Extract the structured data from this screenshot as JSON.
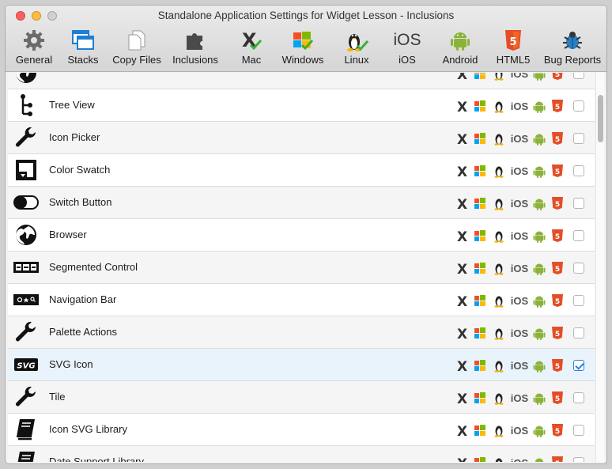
{
  "window": {
    "title": "Standalone Application Settings for Widget Lesson - Inclusions"
  },
  "toolbar": [
    {
      "label": "General",
      "icon": "gear-icon"
    },
    {
      "label": "Stacks",
      "icon": "stacks-icon"
    },
    {
      "label": "Copy Files",
      "icon": "copy-files-icon"
    },
    {
      "label": "Inclusions",
      "icon": "puzzle-icon"
    },
    {
      "label": "Mac",
      "icon": "mac-icon"
    },
    {
      "label": "Windows",
      "icon": "windows-icon"
    },
    {
      "label": "Linux",
      "icon": "linux-icon"
    },
    {
      "label": "iOS",
      "icon": "ios-icon"
    },
    {
      "label": "Android",
      "icon": "android-icon"
    },
    {
      "label": "HTML5",
      "icon": "html5-icon"
    },
    {
      "label": "Bug Reports",
      "icon": "bug-icon"
    }
  ],
  "platform_icons": {
    "ios_text": "iOS"
  },
  "inclusions": [
    {
      "name": "Tree View",
      "icon": "tree-view-icon",
      "checked": false
    },
    {
      "name": "Icon Picker",
      "icon": "wrench-icon",
      "checked": false
    },
    {
      "name": "Color Swatch",
      "icon": "color-swatch-icon",
      "checked": false
    },
    {
      "name": "Switch Button",
      "icon": "switch-icon",
      "checked": false
    },
    {
      "name": "Browser",
      "icon": "globe-icon",
      "checked": false
    },
    {
      "name": "Segmented Control",
      "icon": "segmented-control-icon",
      "checked": false
    },
    {
      "name": "Navigation Bar",
      "icon": "navigation-bar-icon",
      "checked": false
    },
    {
      "name": "Palette Actions",
      "icon": "wrench-icon",
      "checked": false
    },
    {
      "name": "SVG Icon",
      "icon": "svg-icon",
      "checked": true,
      "selected": true
    },
    {
      "name": "Tile",
      "icon": "wrench-icon",
      "checked": false
    },
    {
      "name": "Icon SVG Library",
      "icon": "book-icon",
      "checked": false
    },
    {
      "name": "Date Support Library",
      "icon": "book-icon",
      "checked": false
    }
  ],
  "colors": {
    "selection": "#e9f3fc",
    "accent": "#2c7fe0",
    "html5": "#e44d26",
    "android": "#8bb33a"
  }
}
